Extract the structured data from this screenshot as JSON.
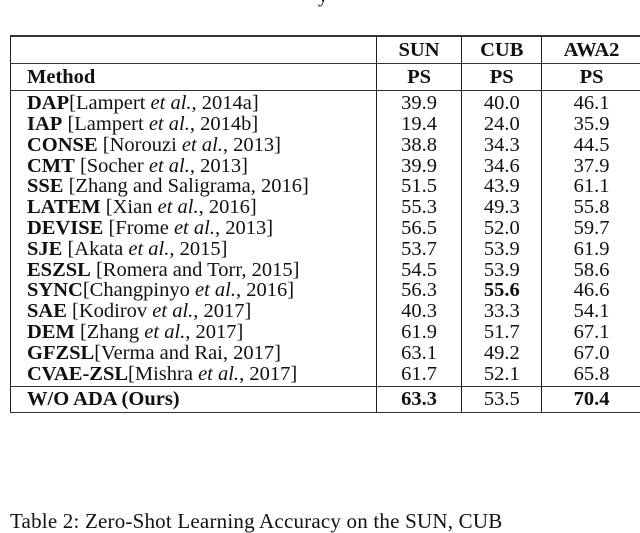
{
  "table": {
    "header_row1": [
      "",
      "SUN",
      "CUB",
      "AWA2"
    ],
    "header_row2": [
      "Method",
      "PS",
      "PS",
      "PS"
    ],
    "rows": [
      {
        "method": "DAP",
        "sep": "",
        "ref_pre": "[Lampert ",
        "ref_it": "et al.",
        "ref_post": ", 2014a]",
        "sun": "39.9",
        "cub": "40.0",
        "awa2": "46.1"
      },
      {
        "method": "IAP",
        "sep": " ",
        "ref_pre": "[Lampert ",
        "ref_it": "et al.",
        "ref_post": ", 2014b]",
        "sun": "19.4",
        "cub": "24.0",
        "awa2": "35.9"
      },
      {
        "method": "CONSE",
        "sep": " ",
        "ref_pre": "[Norouzi ",
        "ref_it": "et al.",
        "ref_post": ", 2013]",
        "sun": "38.8",
        "cub": "34.3",
        "awa2": "44.5"
      },
      {
        "method": "CMT",
        "sep": " ",
        "ref_pre": "[Socher ",
        "ref_it": "et al.",
        "ref_post": ", 2013]",
        "sun": "39.9",
        "cub": "34.6",
        "awa2": "37.9"
      },
      {
        "method": "SSE",
        "sep": " ",
        "ref_pre": "[Zhang and Saligrama, 2016]",
        "ref_it": "",
        "ref_post": "",
        "sun": "51.5",
        "cub": "43.9",
        "awa2": "61.1"
      },
      {
        "method": "LATEM",
        "sep": " ",
        "ref_pre": "[Xian ",
        "ref_it": "et al.",
        "ref_post": ", 2016]",
        "sun": "55.3",
        "cub": "49.3",
        "awa2": "55.8"
      },
      {
        "method": "DEVISE",
        "sep": " ",
        "ref_pre": "[Frome ",
        "ref_it": "et al.",
        "ref_post": ", 2013]",
        "sun": "56.5",
        "cub": "52.0",
        "awa2": "59.7"
      },
      {
        "method": "SJE",
        "sep": " ",
        "ref_pre": "[Akata ",
        "ref_it": "et al.",
        "ref_post": ", 2015]",
        "sun": "53.7",
        "cub": "53.9",
        "awa2": "61.9"
      },
      {
        "method": "ESZSL",
        "sep": " ",
        "ref_pre": "[Romera and Torr, 2015]",
        "ref_it": "",
        "ref_post": "",
        "sun": "54.5",
        "cub": "53.9",
        "awa2": "58.6"
      },
      {
        "method": "SYNC",
        "sep": "",
        "ref_pre": "[Changpinyo ",
        "ref_it": "et al.",
        "ref_post": ", 2016]",
        "sun": "56.3",
        "cub": "55.6",
        "awa2": "46.6",
        "bold": [
          "cub"
        ]
      },
      {
        "method": "SAE",
        "sep": " ",
        "ref_pre": "[Kodirov ",
        "ref_it": "et al.",
        "ref_post": ", 2017]",
        "sun": "40.3",
        "cub": "33.3",
        "awa2": "54.1"
      },
      {
        "method": "DEM",
        "sep": " ",
        "ref_pre": "[Zhang ",
        "ref_it": "et al.",
        "ref_post": ", 2017]",
        "sun": "61.9",
        "cub": "51.7",
        "awa2": "67.1"
      },
      {
        "method": "GFZSL",
        "sep": "",
        "ref_pre": "[Verma and Rai, 2017]",
        "ref_it": "",
        "ref_post": "",
        "sun": "63.1",
        "cub": "49.2",
        "awa2": "67.0"
      },
      {
        "method": "CVAE-ZSL",
        "sep": "",
        "ref_pre": "[Mishra ",
        "ref_it": "et al.",
        "ref_post": ", 2017]",
        "sun": "61.7",
        "cub": "52.1",
        "awa2": "65.8"
      }
    ],
    "ours": {
      "method": "W/O ADA (Ours)",
      "sun": "63.3",
      "cub": "53.5",
      "awa2": "70.4",
      "bold": [
        "sun",
        "awa2"
      ]
    }
  },
  "caption": "Table 2: Zero-Shot Learning Accuracy on the SUN, CUB"
}
